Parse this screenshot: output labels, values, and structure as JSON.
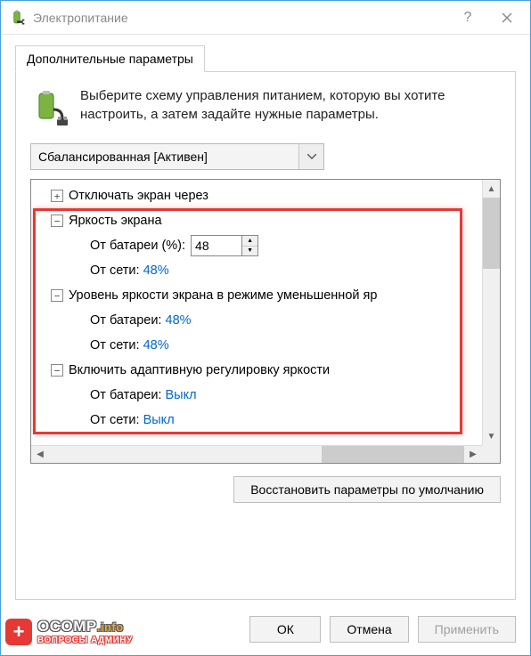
{
  "window": {
    "title": "Электропитание",
    "help_symbol": "?"
  },
  "tab": {
    "label": "Дополнительные параметры"
  },
  "intro": {
    "text": "Выберите схему управления питанием, которую вы хотите настроить, а затем задайте нужные параметры."
  },
  "scheme": {
    "selected": "Сбалансированная [Активен]"
  },
  "tree": {
    "n0": {
      "toggle": "+",
      "label": "Отключать экран через"
    },
    "n1": {
      "toggle": "−",
      "label": "Яркость экрана"
    },
    "n1a_label": "От батареи (%):",
    "n1a_value": "48",
    "n1b_label": "От сети:",
    "n1b_value": "48%",
    "n2": {
      "toggle": "−",
      "label": "Уровень яркости экрана в режиме уменьшенной яр"
    },
    "n2a_label": "От батареи:",
    "n2a_value": "48%",
    "n2b_label": "От сети:",
    "n2b_value": "48%",
    "n3": {
      "toggle": "−",
      "label": "Включить адаптивную регулировку яркости"
    },
    "n3a_label": "От батареи:",
    "n3a_value": "Выкл",
    "n3b_label": "От сети:",
    "n3b_value": "Выкл"
  },
  "buttons": {
    "restore": "Восстановить параметры по умолчанию",
    "ok": "ОК",
    "cancel": "Отмена",
    "apply": "Применить"
  },
  "watermark": {
    "brand": "OCOMP",
    "suffix": ".info",
    "tagline": "ВОПРОСЫ АДМИНУ"
  }
}
